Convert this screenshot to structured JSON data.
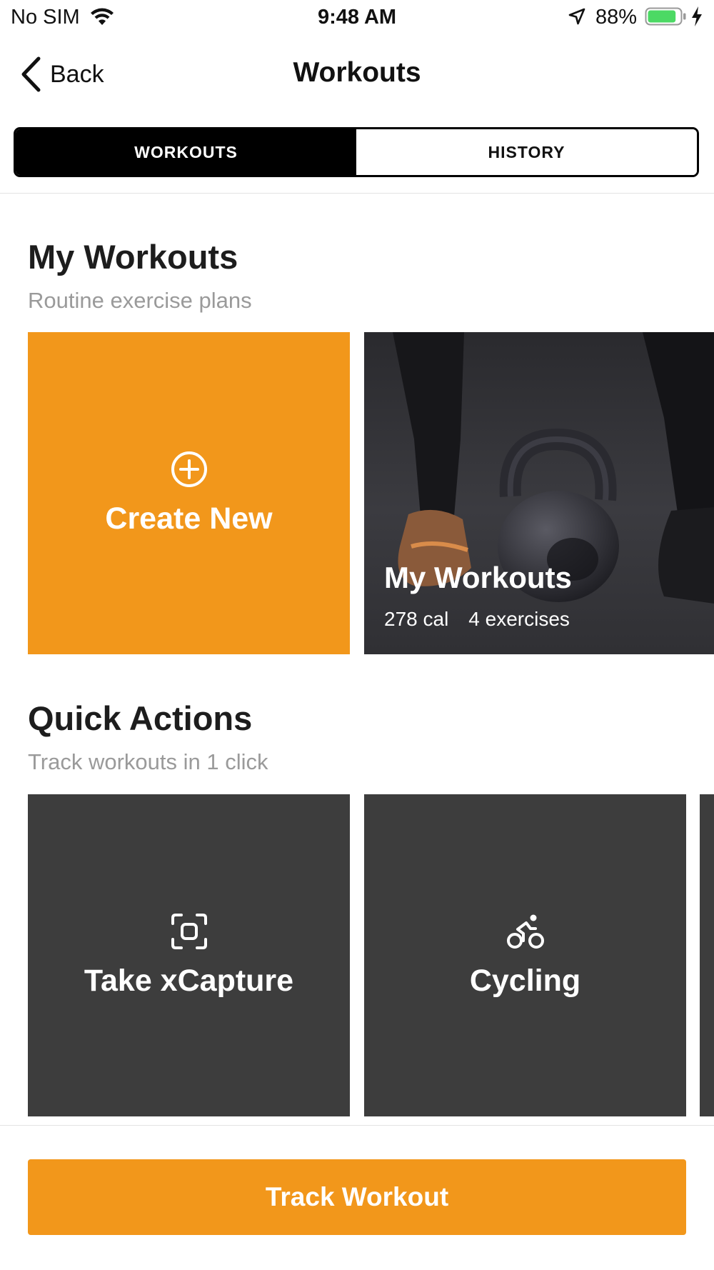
{
  "status_bar": {
    "carrier": "No SIM",
    "time": "9:48 AM",
    "battery_percent": "88%",
    "battery_level": 0.88,
    "battery_color": "#4cd964",
    "icons": [
      "wifi-icon",
      "location-arrow-icon",
      "battery-icon",
      "charging-bolt-icon"
    ]
  },
  "nav": {
    "back_label": "Back",
    "title": "Workouts"
  },
  "tabs": [
    {
      "label": "WORKOUTS",
      "active": true
    },
    {
      "label": "HISTORY",
      "active": false
    }
  ],
  "my_workouts": {
    "title": "My Workouts",
    "subtitle": "Routine exercise plans",
    "create_new": {
      "label": "Create New",
      "icon": "plus-circle-icon"
    },
    "workout_card": {
      "title": "My Workouts",
      "calories": "278 cal",
      "exercises": "4 exercises",
      "image": "kettlebell-photo"
    }
  },
  "quick_actions": {
    "title": "Quick Actions",
    "subtitle": "Track workouts in 1 click",
    "items": [
      {
        "label": "Take xCapture",
        "icon": "capture-frame-icon"
      },
      {
        "label": "Cycling",
        "icon": "cycling-icon"
      }
    ]
  },
  "footer": {
    "track_button": "Track Workout"
  },
  "colors": {
    "accent": "#f2971b",
    "dark_card": "#3d3d3d",
    "text": "#111111",
    "subtitle": "#9a9a9a"
  }
}
